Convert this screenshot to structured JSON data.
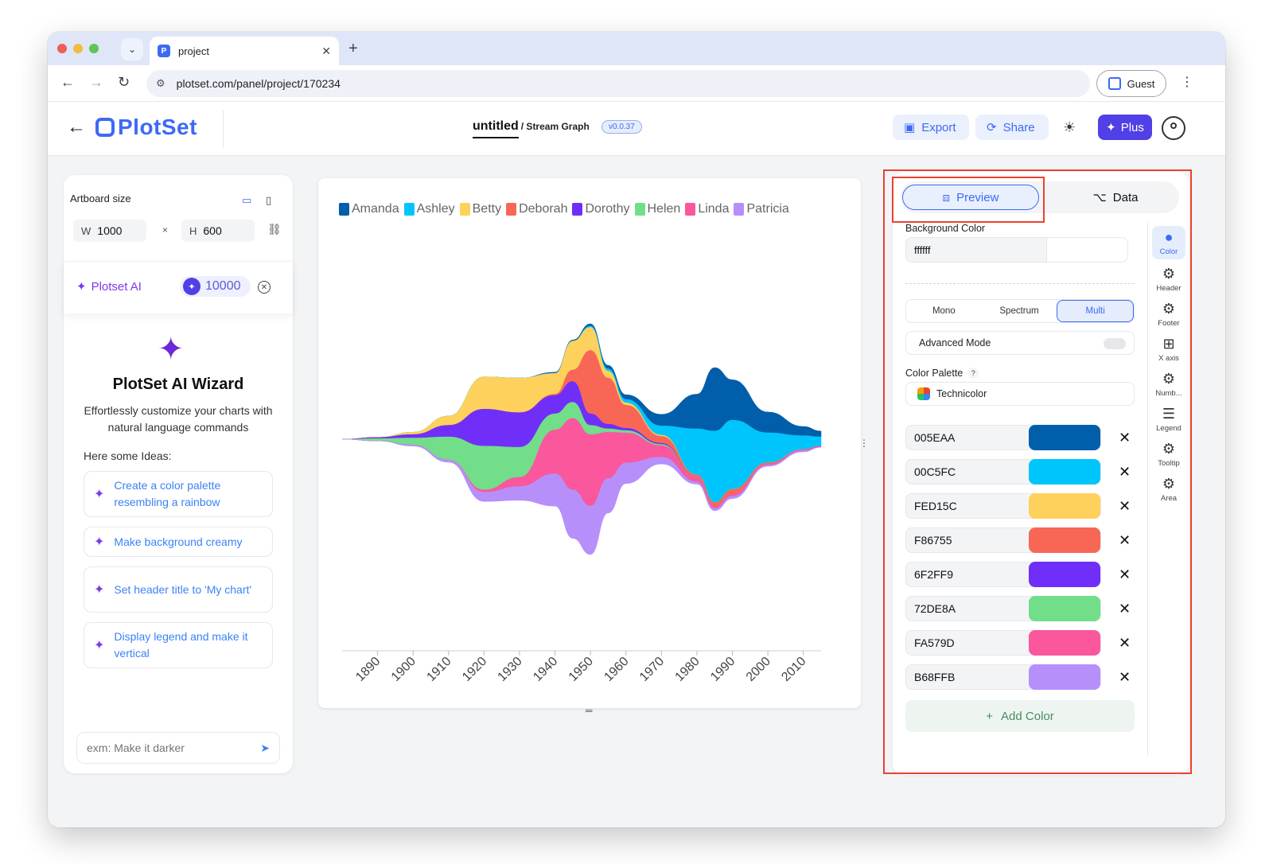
{
  "browser": {
    "tab_title": "project",
    "url": "plotset.com/panel/project/170234",
    "guest_label": "Guest"
  },
  "app": {
    "logo_text": "PlotSet",
    "project_name": "untitled",
    "chart_type": "/ Stream Graph",
    "version": "v0.0.37",
    "export_label": "Export",
    "share_label": "Share",
    "plus_label": "Plus"
  },
  "left_panel": {
    "artboard_label": "Artboard size",
    "width_label": "W",
    "width_value": "1000",
    "height_label": "H",
    "height_value": "600",
    "times": "×",
    "ai_label": "Plotset AI",
    "ai_credits": "10000",
    "wizard_title": "PlotSet AI Wizard",
    "wizard_subtitle": "Effortlessly customize your charts with natural language commands",
    "ideas_label": "Here some Ideas:",
    "ideas": [
      "Create a color palette resembling a rainbow",
      "Make background creamy",
      "Set header title to 'My chart'",
      "Display legend and make it vertical"
    ],
    "prompt_placeholder": "exm: Make it darker"
  },
  "right_panel": {
    "tab_preview": "Preview",
    "tab_data": "Data",
    "bg_color_label": "Background Color",
    "bg_color_value": "ffffff",
    "modes": [
      "Mono",
      "Spectrum",
      "Multi"
    ],
    "active_mode": "Multi",
    "advanced_mode_label": "Advanced Mode",
    "palette_label": "Color Palette",
    "palette_help": "?",
    "palette_value": "Technicolor",
    "colors": [
      "005EAA",
      "00C5FC",
      "FED15C",
      "F86755",
      "6F2FF9",
      "72DE8A",
      "FA579D",
      "B68FFB"
    ],
    "add_color_label": "Add Color",
    "side_tools": [
      "Color",
      "Header",
      "Footer",
      "X axis",
      "Numb...",
      "Legend",
      "Tooltip",
      "Area"
    ]
  },
  "chart_data": {
    "type": "area",
    "subtype": "streamgraph",
    "x": [
      1880,
      1890,
      1900,
      1910,
      1920,
      1930,
      1940,
      1945,
      1950,
      1955,
      1960,
      1970,
      1980,
      1985,
      1990,
      2000,
      2010,
      2015
    ],
    "xticks": [
      "1890",
      "1900",
      "1910",
      "1920",
      "1930",
      "1940",
      "1950",
      "1960",
      "1970",
      "1980",
      "1990",
      "2000",
      "2010"
    ],
    "legend_position": "top-left",
    "series": [
      {
        "name": "Amanda",
        "color": "#005EAA",
        "values": [
          0,
          0,
          0,
          0,
          0,
          0,
          1,
          1,
          2,
          3,
          4,
          10,
          30,
          55,
          35,
          18,
          8,
          5
        ]
      },
      {
        "name": "Ashley",
        "color": "#00C5FC",
        "values": [
          0,
          0,
          0,
          0,
          0,
          0,
          0,
          0,
          1,
          2,
          3,
          8,
          40,
          62,
          60,
          26,
          12,
          8
        ]
      },
      {
        "name": "Betty",
        "color": "#FED15C",
        "values": [
          0,
          0,
          2,
          8,
          28,
          30,
          18,
          25,
          20,
          6,
          2,
          1,
          0,
          0,
          0,
          0,
          0,
          0
        ]
      },
      {
        "name": "Deborah",
        "color": "#F86755",
        "values": [
          0,
          0,
          0,
          0,
          0,
          0,
          1,
          10,
          55,
          40,
          20,
          6,
          2,
          3,
          4,
          1,
          0,
          0
        ]
      },
      {
        "name": "Dorothy",
        "color": "#6F2FF9",
        "values": [
          0,
          1,
          3,
          10,
          32,
          30,
          16,
          18,
          10,
          4,
          2,
          1,
          0,
          0,
          0,
          0,
          0,
          0
        ]
      },
      {
        "name": "Helen",
        "color": "#72DE8A",
        "values": [
          0,
          2,
          6,
          20,
          38,
          26,
          14,
          14,
          8,
          3,
          2,
          1,
          0,
          0,
          0,
          0,
          0,
          0
        ]
      },
      {
        "name": "Linda",
        "color": "#FA579D",
        "values": [
          0,
          0,
          0,
          0,
          2,
          8,
          38,
          62,
          62,
          40,
          26,
          10,
          4,
          2,
          2,
          1,
          1,
          1
        ]
      },
      {
        "name": "Patricia",
        "color": "#B68FFB",
        "values": [
          0,
          0,
          1,
          2,
          8,
          12,
          28,
          42,
          42,
          30,
          18,
          6,
          2,
          2,
          2,
          1,
          1,
          0
        ]
      }
    ]
  }
}
